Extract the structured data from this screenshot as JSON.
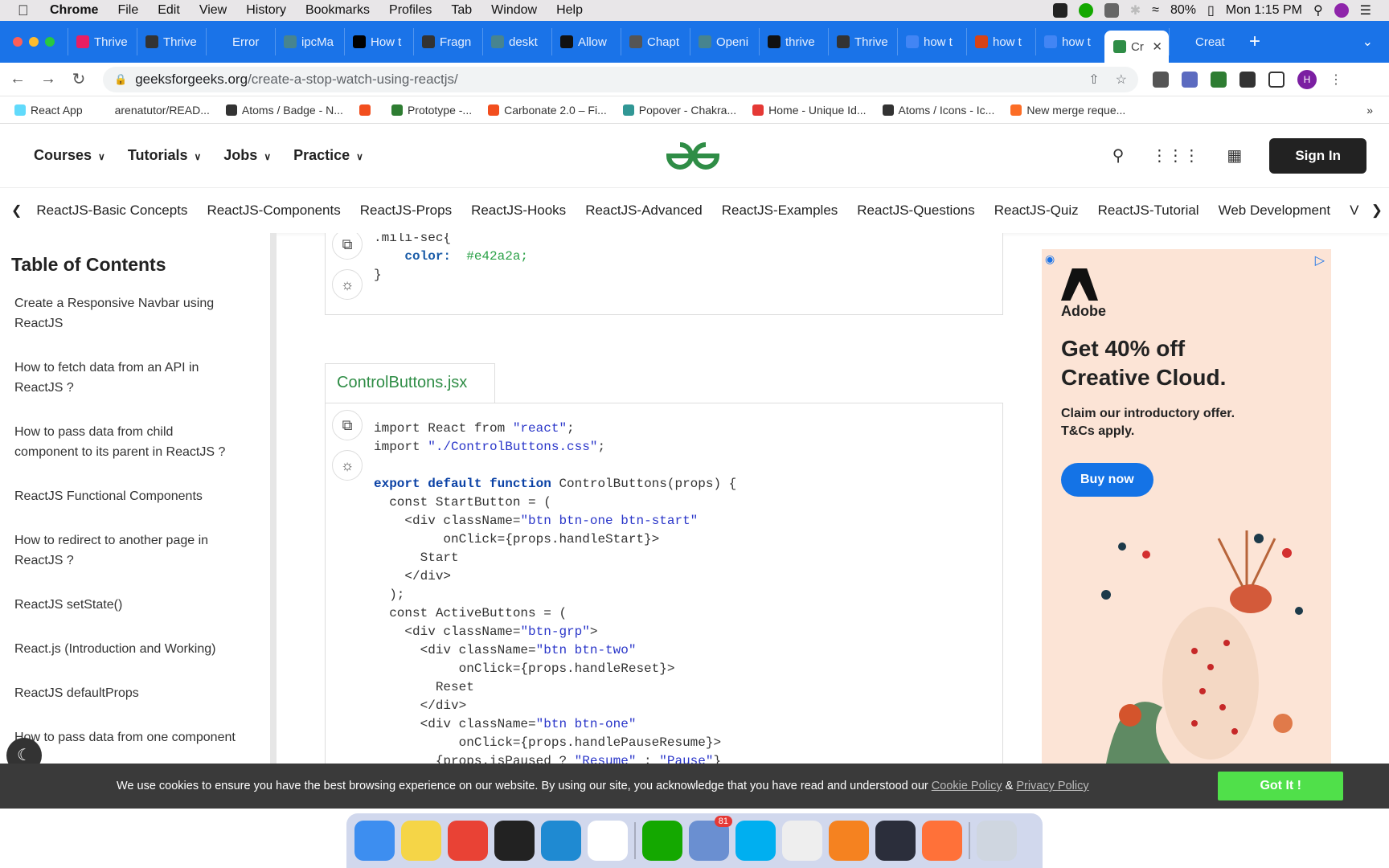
{
  "menubar": {
    "app": "Chrome",
    "items": [
      "File",
      "Edit",
      "View",
      "History",
      "Bookmarks",
      "Profiles",
      "Tab",
      "Window",
      "Help"
    ],
    "battery": "80%",
    "clock": "Mon 1:15 PM"
  },
  "tabs": [
    {
      "label": "Thrive",
      "color": "#e91e63"
    },
    {
      "label": "Thrive",
      "color": "#333"
    },
    {
      "label": "Error",
      "color": "#1a73e8"
    },
    {
      "label": "ipcMa",
      "color": "#47848f"
    },
    {
      "label": "How t",
      "color": "#000"
    },
    {
      "label": "Fragn",
      "color": "#333"
    },
    {
      "label": "deskt",
      "color": "#47848f"
    },
    {
      "label": "Allow",
      "color": "#111"
    },
    {
      "label": "Chapt",
      "color": "#555"
    },
    {
      "label": "Openi",
      "color": "#47848f"
    },
    {
      "label": "thrive",
      "color": "#111"
    },
    {
      "label": "Thrive",
      "color": "#333"
    },
    {
      "label": "how t",
      "color": "#4285f4"
    },
    {
      "label": "how t",
      "color": "#d84315"
    },
    {
      "label": "how t",
      "color": "#4285f4"
    }
  ],
  "active_tab": {
    "label": "Cr"
  },
  "last_tab": {
    "label": "Creat"
  },
  "url": {
    "domain": "geeksforgeeks.org",
    "path": "/create-a-stop-watch-using-reactjs/"
  },
  "profile_initial": "H",
  "bookmarks": [
    {
      "label": "React App",
      "color": "#61dafb"
    },
    {
      "label": "arenatutor/READ...",
      "color": "#fff"
    },
    {
      "label": "Atoms / Badge - N...",
      "color": "#333"
    },
    {
      "label": "",
      "color": "#f24e1e"
    },
    {
      "label": "Prototype -...",
      "color": "#2e7d32"
    },
    {
      "label": "Carbonate 2.0 – Fi...",
      "color": "#f24e1e"
    },
    {
      "label": "Popover - Chakra...",
      "color": "#319795"
    },
    {
      "label": "Home - Unique Id...",
      "color": "#e53935"
    },
    {
      "label": "Atoms / Icons - Ic...",
      "color": "#333"
    },
    {
      "label": "New merge reque...",
      "color": "#fc6d26"
    }
  ],
  "gfg_nav": [
    "Courses",
    "Tutorials",
    "Jobs",
    "Practice"
  ],
  "sign_in": "Sign In",
  "topics": [
    "ReactJS-Basic Concepts",
    "ReactJS-Components",
    "ReactJS-Props",
    "ReactJS-Hooks",
    "ReactJS-Advanced",
    "ReactJS-Examples",
    "ReactJS-Questions",
    "ReactJS-Quiz",
    "ReactJS-Tutorial",
    "Web Development",
    "V"
  ],
  "toc": {
    "title": "Table of Contents",
    "items": [
      "Create a Responsive Navbar using ReactJS",
      "How to fetch data from an API in ReactJS ?",
      "How to pass data from child component to its parent in ReactJS ?",
      "ReactJS Functional Components",
      "How to redirect to another page in ReactJS ?",
      "ReactJS setState()",
      "React.js (Introduction and Working)",
      "ReactJS defaultProps",
      "How to pass data from one component"
    ]
  },
  "css_block": {
    "selector": ".mili-sec{",
    "property": "color:",
    "value": "#e42a2a;",
    "close": "}"
  },
  "file_tab": "ControlButtons.jsx",
  "code_lines": [
    "import React from \"react\";",
    "import \"./ControlButtons.css\";",
    "",
    "export default function ControlButtons(props) {",
    "  const StartButton = (",
    "    <div className=\"btn btn-one btn-start\"",
    "         onClick={props.handleStart}>",
    "      Start",
    "    </div>",
    "  );",
    "  const ActiveButtons = (",
    "    <div className=\"btn-grp\">",
    "      <div className=\"btn btn-two\"",
    "           onClick={props.handleReset}>",
    "        Reset",
    "      </div>",
    "      <div className=\"btn btn-one\"",
    "           onClick={props.handlePauseResume}>",
    "        {props.isPaused ? \"Resume\" : \"Pause\"}"
  ],
  "ad": {
    "brand": "Adobe",
    "headline": "Get 40% off Creative Cloud.",
    "sub": "Claim our introductory offer. T&Cs apply.",
    "cta": "Buy now"
  },
  "cookie": {
    "text": "We use cookies to ensure you have the best browsing experience on our website. By using our site, you acknowledge that you have read and understood our",
    "policy1": "Cookie Policy",
    "amp": "&",
    "policy2": "Privacy Policy",
    "button": "Got It !"
  },
  "dock": [
    {
      "name": "finder-icon",
      "color": "#3d8ef0"
    },
    {
      "name": "notes-icon",
      "color": "#f5d547"
    },
    {
      "name": "chrome-icon",
      "color": "#e94235"
    },
    {
      "name": "terminal-icon",
      "color": "#222"
    },
    {
      "name": "vscode-icon",
      "color": "#1f8ad2"
    },
    {
      "name": "slack-icon",
      "color": "#fff"
    },
    {
      "name": "upwork-icon",
      "color": "#14a800"
    },
    {
      "name": "mail-icon",
      "color": "#6a8fd1",
      "badge": "81"
    },
    {
      "name": "skype-icon",
      "color": "#00aff0"
    },
    {
      "name": "textedit-icon",
      "color": "#eee"
    },
    {
      "name": "pen-icon",
      "color": "#f58220"
    },
    {
      "name": "electron-icon",
      "color": "#2b2e3b"
    },
    {
      "name": "firefox-icon",
      "color": "#ff7139"
    },
    {
      "name": "trash-icon",
      "color": "#cfd6e0"
    }
  ]
}
